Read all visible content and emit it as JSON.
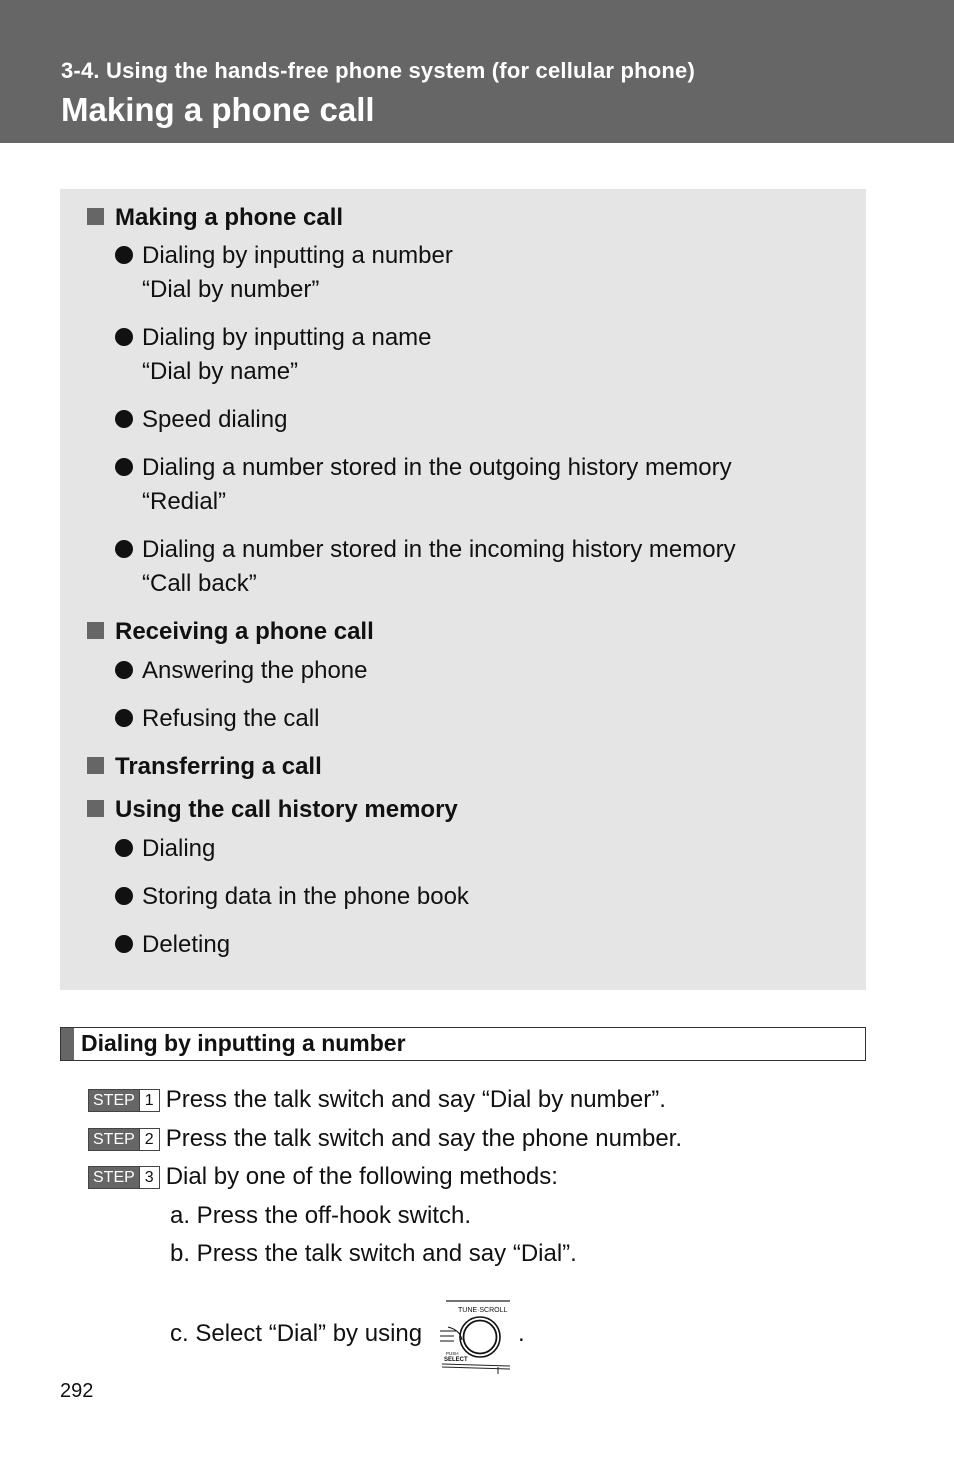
{
  "header": {
    "section": "3-4. Using the hands-free phone system (for cellular phone)",
    "title": "Making a phone call"
  },
  "summary": {
    "groups": [
      {
        "heading": "Making a phone call",
        "items": [
          {
            "label": "Dialing by inputting a number",
            "command": "“Dial by number”"
          },
          {
            "label": "Dialing by inputting a name",
            "command": "“Dial by name”"
          },
          {
            "label": "Speed dialing"
          },
          {
            "label": "Dialing a number stored in the outgoing history memory",
            "command": "“Redial”"
          },
          {
            "label": "Dialing a number stored in the incoming history memory",
            "command": "“Call back”"
          }
        ]
      },
      {
        "heading": "Receiving a phone call",
        "items": [
          {
            "label": "Answering the phone"
          },
          {
            "label": "Refusing the call"
          }
        ]
      },
      {
        "heading": "Transferring a call",
        "items": []
      },
      {
        "heading": "Using the call history memory",
        "items": [
          {
            "label": "Dialing"
          },
          {
            "label": "Storing data in the phone book"
          },
          {
            "label": "Deleting"
          }
        ]
      }
    ]
  },
  "procedure": {
    "heading": "Dialing by inputting a number",
    "step_label": "STEP",
    "steps": [
      {
        "number": "1",
        "text": "Press the talk switch and say “Dial by number”."
      },
      {
        "number": "2",
        "text": "Press the talk switch and say the phone number."
      },
      {
        "number": "3",
        "text": "Dial by one of the following methods:"
      }
    ],
    "methods": [
      "a. Press the off-hook switch.",
      "b. Press the talk switch and say “Dial”.",
      "c. Select “Dial” by using"
    ],
    "method_end": ".",
    "knob": {
      "top_label": "TUNE·SCROLL",
      "push_label": "PUSH",
      "select_label": "SELECT"
    }
  },
  "page_number": "292"
}
